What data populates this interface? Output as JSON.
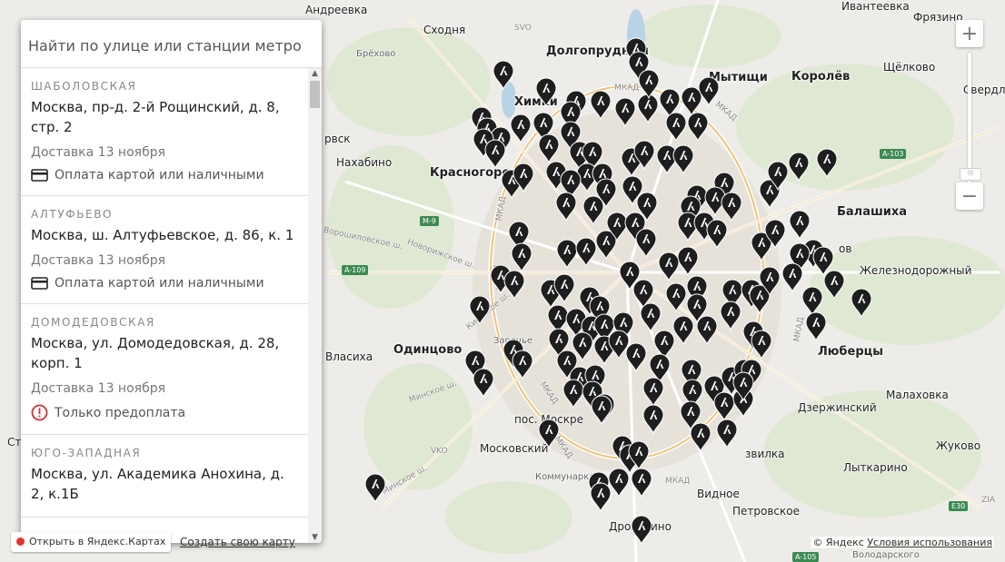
{
  "search": {
    "placeholder": "Найти по улице или станции метро"
  },
  "pickup_points": [
    {
      "station": "ШАБОЛОВСКАЯ",
      "address": "Москва, пр-д. 2-й Рощинский, д. 8, стр. 2",
      "delivery": "Доставка 13 ноября",
      "payment": "Оплата картой или наличными",
      "payment_icon": "card-icon"
    },
    {
      "station": "АЛТУФЬЕВО",
      "address": "Москва, ш. Алтуфьевское, д. 86, к. 1",
      "delivery": "Доставка 13 ноября",
      "payment": "Оплата картой или наличными",
      "payment_icon": "card-icon"
    },
    {
      "station": "ДОМОДЕДОВСКАЯ",
      "address": "Москва, ул. Домодедовская, д. 28, корп. 1",
      "delivery": "Доставка 13 ноября",
      "payment": "Только предоплата",
      "payment_icon": "alert-icon"
    },
    {
      "station": "ЮГО-ЗАПАДНАЯ",
      "address": "Москва, ул. Академика Анохина, д. 2, к.1Б",
      "delivery": "",
      "payment": "",
      "payment_icon": ""
    }
  ],
  "map": {
    "places_big": [
      "Мытищи",
      "Королёв",
      "Балашиха",
      "Одинцово",
      "Люберцы",
      "Химки",
      "Красногорск",
      "Долгопрудный"
    ],
    "places_mid": [
      "Андреевка",
      "Ивантеевка",
      "Фрязино",
      "Сходня",
      "Щёлково",
      "Свердл",
      "Нахабино",
      "Железнодорожный",
      "Власиха",
      "Заречье",
      "Дзержинский",
      "Малаховка",
      "Московский",
      "пос. Москре",
      "Жуково",
      "Лыткарино",
      "Видное",
      "Петровское",
      "Коммунарка",
      "Дрожжино",
      "Ст",
      "рвск",
      "звилка",
      "Володарского",
      "Брёхово",
      "ов"
    ],
    "road_labels": [
      "МКАД",
      "МКАД",
      "МКАД",
      "МКАД",
      "МКАД",
      "МКАД",
      "МКАД",
      "Минское ш.",
      "Минское ш.",
      "Киевское ш.",
      "Ворошиловское ш.",
      "Новорижское ш.",
      "МКАД"
    ],
    "shields": [
      "M-9",
      "A-109",
      "A-103",
      "E30",
      "A-105",
      "SVO",
      "VKO",
      "ZIA"
    ],
    "accent_color": "#1e1e1e",
    "marker_icon": "pickup-point-marker-icon"
  },
  "controls": {
    "zoom_in": "+",
    "zoom_out": "−",
    "zoom_level": 0.15
  },
  "bottom": {
    "open_in_yandex": "Открыть в Яндекс.Картах",
    "create_map": "Создать свою карту",
    "copyright": "© Яндекс",
    "terms": "Условия использования"
  }
}
